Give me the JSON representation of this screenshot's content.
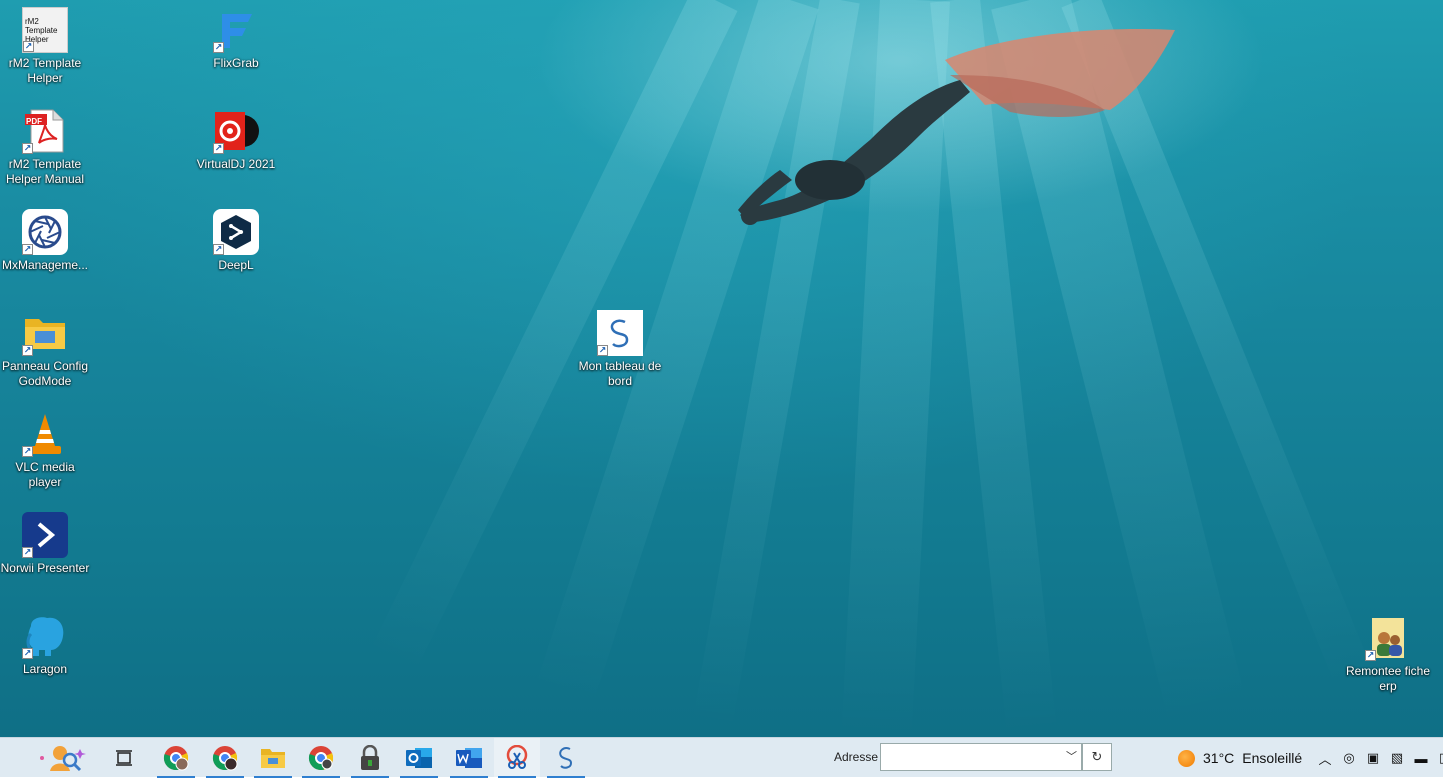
{
  "desktop": {
    "icons": [
      {
        "label": "rM2 Template Helper",
        "thumb": "rM2 Template Helper",
        "icon": "template-thumbnail-icon"
      },
      {
        "label": "rM2 Template Helper Manual",
        "badge": "PDF",
        "icon": "pdf-icon"
      },
      {
        "label": "MxManageme...",
        "icon": "aperture-icon"
      },
      {
        "label": "Panneau Config GodMode",
        "icon": "folder-icon"
      },
      {
        "label": "VLC media player",
        "icon": "vlc-cone-icon"
      },
      {
        "label": "Norwii Presenter",
        "icon": "chevron-right-icon"
      },
      {
        "label": "Laragon",
        "icon": "elephant-icon"
      },
      {
        "label": "FlixGrab",
        "icon": "flixgrab-icon"
      },
      {
        "label": "VirtualDJ 2021",
        "icon": "virtualdj-icon"
      },
      {
        "label": "DeepL",
        "icon": "deepl-icon"
      },
      {
        "label": "Mon tableau de bord",
        "icon": "dashboard-swirl-icon"
      },
      {
        "label": "Remontee fiche erp",
        "icon": "users-folder-icon"
      }
    ]
  },
  "taskbar": {
    "apps": [
      {
        "name": "search-assistant",
        "icon": "search-assistant-icon"
      },
      {
        "name": "task-view",
        "icon": "task-view-icon"
      },
      {
        "name": "chrome-profile-1",
        "icon": "chrome-icon"
      },
      {
        "name": "chrome-profile-2",
        "icon": "chrome-icon"
      },
      {
        "name": "file-explorer",
        "icon": "folder-icon"
      },
      {
        "name": "chrome-3",
        "icon": "chrome-icon"
      },
      {
        "name": "keepass",
        "icon": "lock-icon"
      },
      {
        "name": "outlook",
        "icon": "outlook-icon"
      },
      {
        "name": "word",
        "icon": "word-icon"
      },
      {
        "name": "snipping",
        "icon": "scissors-icon"
      },
      {
        "name": "dashboard",
        "icon": "dashboard-swirl-icon"
      }
    ],
    "address_label": "Adresse",
    "address_value": "",
    "weather": {
      "temp": "31°C",
      "condition": "Ensoleillé"
    }
  },
  "colors": {
    "taskbar_bg": "#dfeaf2",
    "accent": "#2f7fd0",
    "water": "#16839a"
  }
}
